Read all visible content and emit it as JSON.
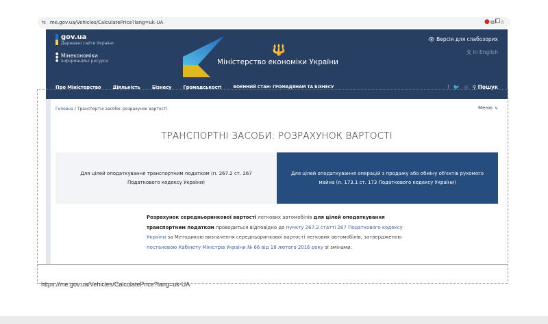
{
  "browser": {
    "url": "me.gov.ua/Vehicles/CalculatePrice?lang=uk-UA"
  },
  "header": {
    "gov_title": "gov.ua",
    "gov_sub": "Державні сайти України",
    "min_title": "Мінекономіки",
    "min_sub": "Інформаційні ресурси",
    "ministry": "Міністерство економіки України",
    "accessibility": "Версія для слабозорих",
    "english": "In English"
  },
  "nav": {
    "items": [
      "Про Міністерство",
      "Діяльність",
      "Бізнесу",
      "Громадськості",
      "Воєнний стан: громадянам та бізнесу"
    ],
    "search": "Пошук"
  },
  "breadcrumb": {
    "home": "Головна",
    "current": "Транспортні засоби: розрахунок вартості"
  },
  "menu": "Меню",
  "title": "ТРАНСПОРТНІ ЗАСОБИ: РОЗРАХУНОК ВАРТОСТІ",
  "tabs": [
    "Для цілей оподаткування транспортним податком (п. 267.2 ст. 267 Податкового кодексу України)",
    "Для цілей оподаткування операцій з продажу або обміну об'єктів рухомого майна (п. 173.1 ст. 173 Податкового кодексу України)"
  ],
  "para": {
    "b1": "Розрахунок середньоринкової вартості",
    "t1": " легкових автомобілів ",
    "b2": "для цілей оподаткування транспортним податком",
    "t2": " проводиться відповідно до ",
    "l1": "пункту 267.2 статті 267 Податкового кодексу України",
    "t3": " за Методикою визначення середньоринкової вартості легкових автомобілів, затвердженою ",
    "l2": "постановою Кабінету Міністрів України № 66 від 18 лютого 2016 року",
    "t4": " зі змінами."
  },
  "caption_url": "https://me.gov.ua/Vehicles/CalculatePrice?lang=uk-UA"
}
